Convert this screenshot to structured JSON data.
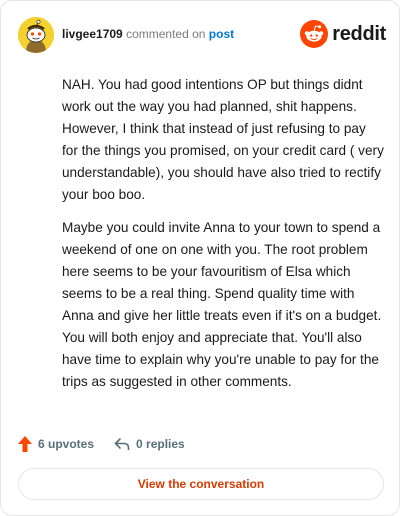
{
  "header": {
    "username": "livgee1709",
    "commented_text": "commented on",
    "post_link": "post",
    "brand": "reddit"
  },
  "comment": {
    "paragraphs": [
      "NAH. You had good intentions OP but things didnt work out the way you had planned, shit happens. However, I think that instead of just refusing to pay for the things you promised, on your credit card ( very understandable), you should have also tried to rectify your boo boo.",
      "Maybe you could invite Anna to your town to spend a weekend of one on one with you. The root problem here seems to be your favouritism of Elsa which seems to be a real thing. Spend quality time with Anna and give her little treats even if it's on a budget. You will both enjoy and appreciate that. You'll also have time to explain why you're unable to pay for the trips as suggested in other comments."
    ]
  },
  "actions": {
    "upvotes": "6 upvotes",
    "replies": "0 replies"
  },
  "view_button": "View the conversation",
  "icons": {
    "avatar": "snoo-avatar-icon",
    "brand": "reddit-logo-icon",
    "upvote": "upvote-arrow-icon",
    "reply": "reply-arrow-icon"
  },
  "colors": {
    "accent": "#ff4500",
    "link": "#0079d3",
    "button_text": "#d93a00",
    "avatar_bg": "#f5d130",
    "muted": "#576f76"
  }
}
